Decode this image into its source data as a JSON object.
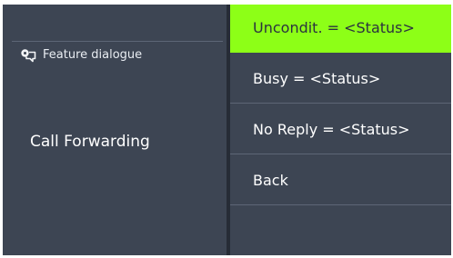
{
  "screen": {
    "feature_dialogue_label": "Feature dialogue",
    "feature_title": "Call Forwarding",
    "menu": [
      {
        "label": "Uncondit. = <Status>",
        "selected": true
      },
      {
        "label": "Busy = <Status>",
        "selected": false
      },
      {
        "label": "No Reply = <Status>",
        "selected": false
      },
      {
        "label": "Back",
        "selected": false
      },
      {
        "label": "",
        "selected": false
      }
    ],
    "colors": {
      "background": "#3d4553",
      "highlight": "#8dff17",
      "divider": "#262c36",
      "text": "#ffffff"
    },
    "icons": {
      "feature_dialogue": "feature-dialogue-icon"
    }
  }
}
